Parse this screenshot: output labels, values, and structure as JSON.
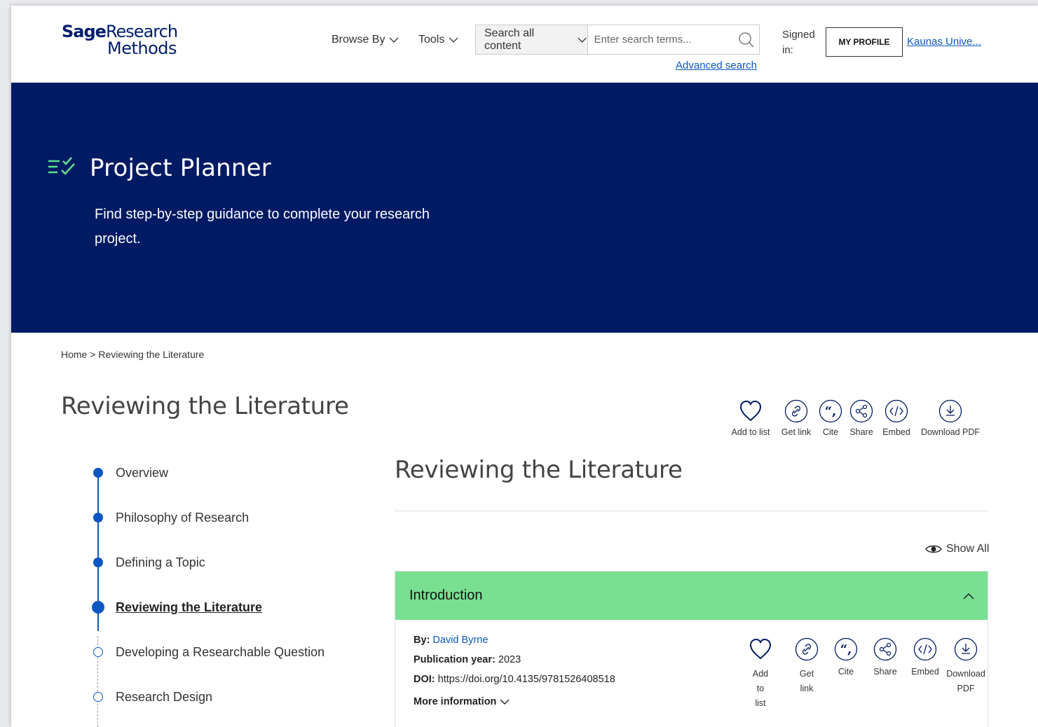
{
  "header": {
    "logo_line1_bold": "Sage",
    "logo_line1_rest": "Research",
    "logo_line2": "Methods",
    "browse_by": "Browse By",
    "tools": "Tools",
    "search_scope": "Search all content",
    "search_placeholder": "Enter search terms...",
    "advanced_search": "Advanced search",
    "signed_in": "Signed in:",
    "my_profile": "MY PROFILE",
    "institution": "Kaunas Unive..."
  },
  "hero": {
    "title": "Project Planner",
    "description": "Find step-by-step guidance to complete your research project."
  },
  "breadcrumb": {
    "home": "Home",
    "separator": ">",
    "current": "Reviewing the Literature"
  },
  "page_title": "Reviewing the Literature",
  "top_actions": [
    "Add to list",
    "Get link",
    "Cite",
    "Share",
    "Embed",
    "Download PDF"
  ],
  "steps": [
    {
      "label": "Overview",
      "state": "done"
    },
    {
      "label": "Philosophy of Research",
      "state": "done"
    },
    {
      "label": "Defining a Topic",
      "state": "done"
    },
    {
      "label": "Reviewing the Literature",
      "state": "current"
    },
    {
      "label": "Developing a Researchable Question",
      "state": "todo"
    },
    {
      "label": "Research Design",
      "state": "todo"
    }
  ],
  "content": {
    "title": "Reviewing the Literature",
    "show_all": "Show All",
    "section_title": "Introduction",
    "by_label": "By:",
    "author": "David Byrne",
    "pub_year_label": "Publication year:",
    "pub_year": "2023",
    "doi_label": "DOI:",
    "doi": "https://doi.org/10.4135/9781526408518",
    "more_info": "More information",
    "actions": {
      "add_l1": "Add",
      "add_l2": "to",
      "add_l3": "list",
      "link_l1": "Get",
      "link_l2": "link",
      "cite": "Cite",
      "share": "Share",
      "embed": "Embed",
      "pdf_l1": "Download",
      "pdf_l2": "PDF"
    }
  },
  "colors": {
    "hero_bg": "#001a64",
    "accent_blue": "#0a57c2",
    "accordion_green": "#79e092",
    "check_green": "#5fe08a"
  },
  "icons": [
    "chevron-down-icon",
    "search-icon",
    "checklist-icon",
    "heart-icon",
    "link-icon",
    "quote-icon",
    "share-icon",
    "code-icon",
    "download-icon",
    "eye-icon",
    "chevron-up-icon"
  ]
}
